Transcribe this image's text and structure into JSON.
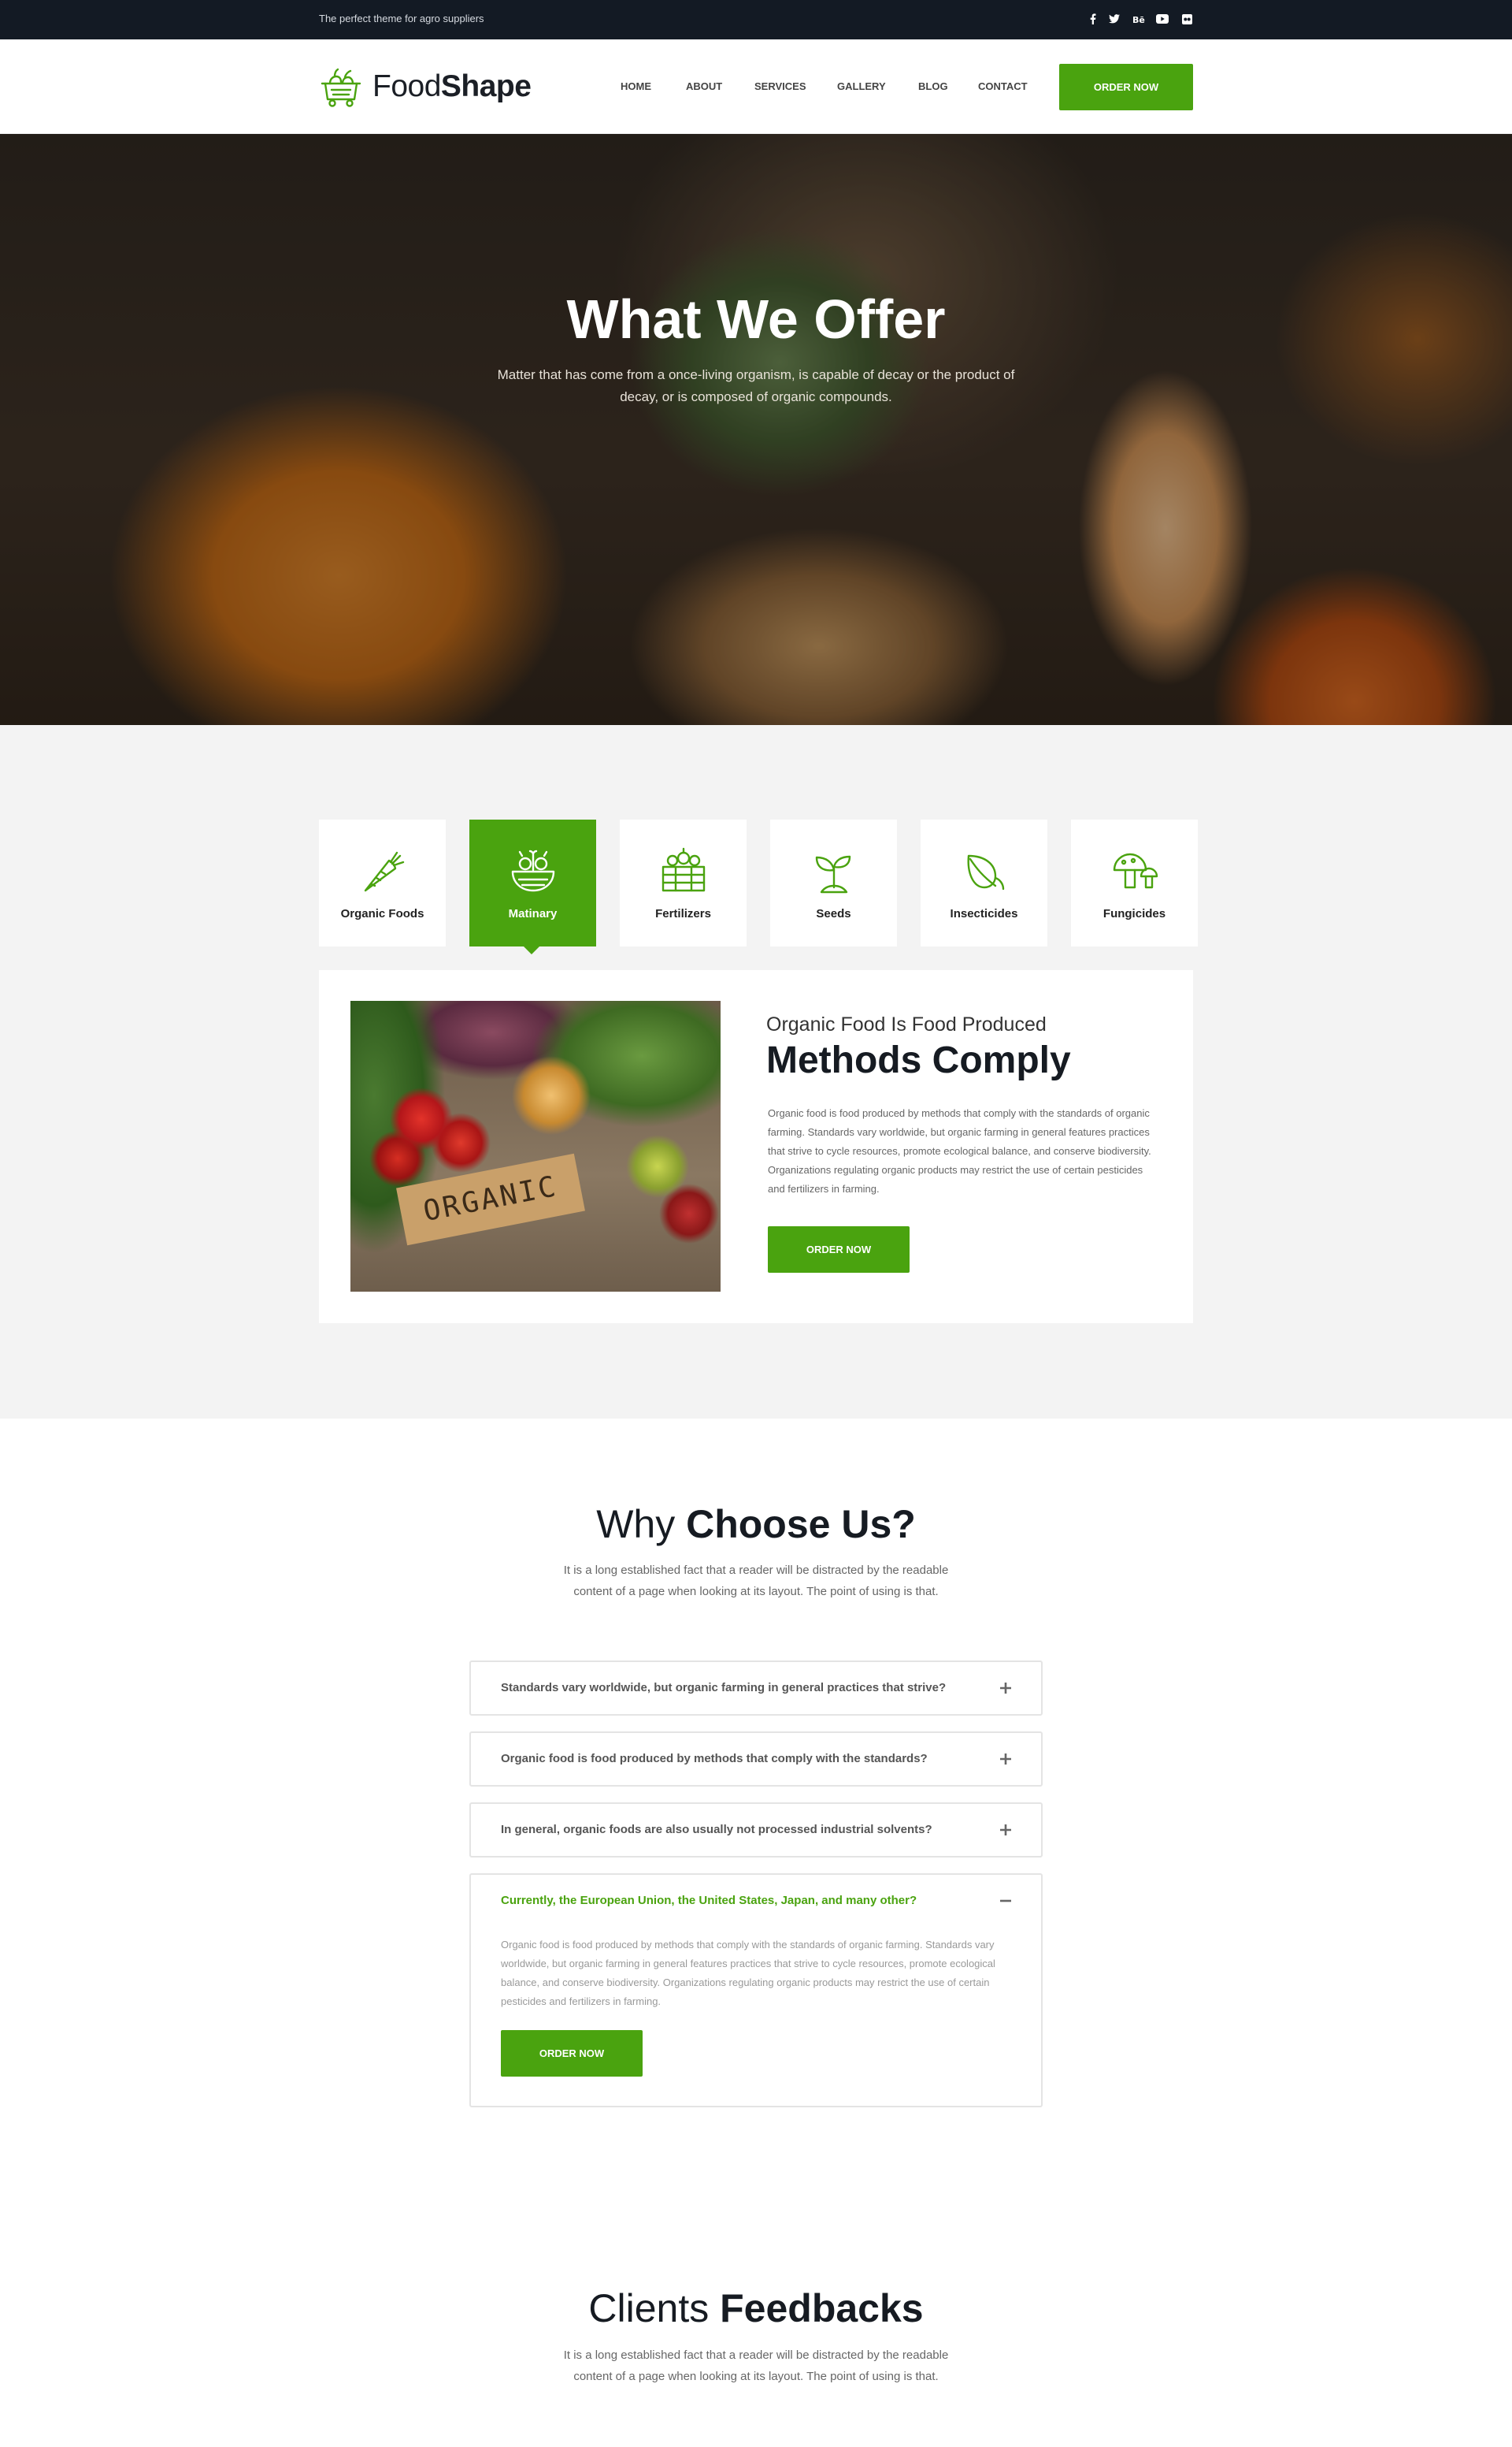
{
  "topbar": {
    "tagline": "The perfect theme for agro suppliers",
    "social_icons": [
      "facebook-icon",
      "twitter-icon",
      "behance-icon",
      "youtube-icon",
      "flickr-icon"
    ]
  },
  "header": {
    "logo": {
      "light": "Food",
      "bold": "Shape"
    },
    "nav": [
      "HOME",
      "ABOUT",
      "SERVICES",
      "GALLERY",
      "BLOG",
      "CONTACT"
    ],
    "cta": "ORDER NOW"
  },
  "hero": {
    "title": "What We Offer",
    "subtitle": "Matter that has come from a once-living organism, is capable of decay or the product of decay, or is composed of organic compounds."
  },
  "offer": {
    "tabs": [
      {
        "label": "Organic Foods",
        "icon": "carrot-icon"
      },
      {
        "label": "Matinary",
        "icon": "vegetable-basket-icon",
        "active": true
      },
      {
        "label": "Fertilizers",
        "icon": "crate-icon"
      },
      {
        "label": "Seeds",
        "icon": "sprout-icon"
      },
      {
        "label": "Insecticides",
        "icon": "leaf-icon"
      },
      {
        "label": "Fungicides",
        "icon": "mushroom-icon"
      }
    ],
    "image_sign": "ORGANIC",
    "pretitle": "Organic Food Is Food Produced",
    "title": "Methods Comply",
    "text": "Organic food is food produced by methods that comply with the standards of organic farming. Standards vary worldwide, but organic farming in general features practices that strive to cycle resources, promote ecological balance, and conserve biodiversity. Organizations regulating organic products may restrict the use of certain pesticides and fertilizers in farming.",
    "cta": "ORDER NOW"
  },
  "why": {
    "title_light": "Why ",
    "title_bold": "Choose Us?",
    "subtitle": "It is a long established fact that a reader will be distracted by the readable content of a page when looking at its layout. The point of using is that.",
    "faqs": [
      {
        "q": "Standards vary worldwide, but organic farming in general practices that strive?",
        "open": false
      },
      {
        "q": "Organic food is food produced by methods that comply with the standards?",
        "open": false
      },
      {
        "q": "In general, organic foods are also usually not processed industrial solvents?",
        "open": false
      },
      {
        "q": "Currently, the European Union, the United States, Japan, and many other?",
        "open": true,
        "a": "Organic food is food produced by methods that comply with the standards of organic farming. Standards vary worldwide, but organic farming in general features practices that strive to cycle resources, promote ecological balance, and conserve biodiversity. Organizations regulating organic products may restrict the use of certain pesticides and fertilizers in farming.",
        "cta": "ORDER NOW"
      }
    ]
  },
  "feedback": {
    "title_light": "Clients ",
    "title_bold": "Feedbacks",
    "subtitle": "It is a long established fact that a reader will be distracted by the readable content of a page when looking at its layout. The point of using is that."
  },
  "colors": {
    "accent": "#4aa30f",
    "topbar": "#131a24",
    "section_bg": "#f3f3f3"
  }
}
